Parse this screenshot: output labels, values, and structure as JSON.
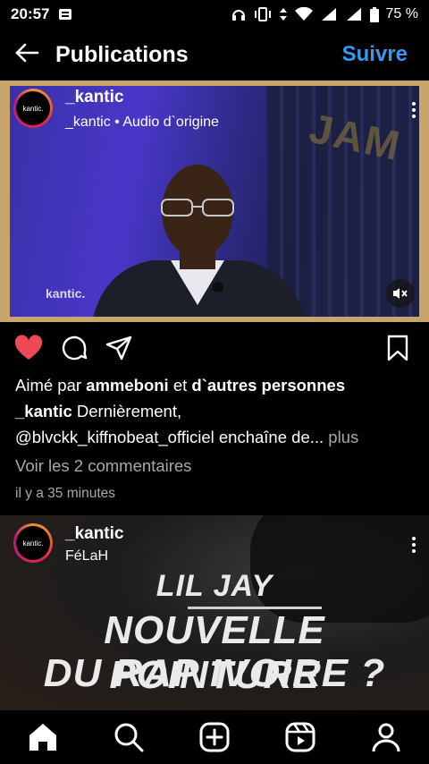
{
  "status": {
    "time": "20:57",
    "battery": "75 %"
  },
  "header": {
    "title": "Publications",
    "follow": "Suivre"
  },
  "post1": {
    "username": "_kantic",
    "subtitle_user": "_kantic",
    "subtitle_audio": "Audio d`origine",
    "avatar_text": "kantic.",
    "watermark": "kantic.",
    "backdrop_text": "JAM",
    "liked_prefix": "Aimé par ",
    "liked_user": "ammeboni",
    "liked_mid": " et ",
    "liked_others": "d`autres personnes",
    "caption_user": "_kantic",
    "caption_text": " Dernièrement,",
    "caption_mention": "@blvckk_kiffnobeat_officiel",
    "caption_rest": " enchaîne de...",
    "caption_more": " plus",
    "comments": "Voir les 2 commentaires",
    "time": "il y a 35 minutes"
  },
  "post2": {
    "username": "_kantic",
    "subtitle": "FéLaH",
    "avatar_text": "kantic.",
    "overlay_top": "LIL JAY",
    "overlay_line1": "NOUVELLE POINTURE",
    "overlay_line2": "DU RAP IVOIRE ?"
  },
  "nav": [
    "home-icon",
    "search-icon",
    "add-icon",
    "reels-icon",
    "profile-icon"
  ],
  "colors": {
    "accent": "#3897f0",
    "like": "#ed4956"
  }
}
